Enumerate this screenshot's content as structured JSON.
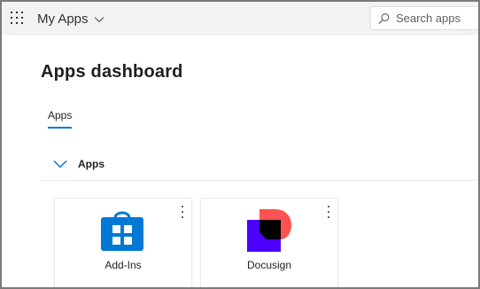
{
  "header": {
    "app_title": "My Apps",
    "search_placeholder": "Search apps"
  },
  "page": {
    "title": "Apps dashboard",
    "tabs": [
      {
        "label": "Apps",
        "selected": true
      }
    ]
  },
  "section": {
    "label": "Apps",
    "expanded": true
  },
  "apps": [
    {
      "name": "Add-Ins",
      "icon": "store-bag-icon"
    },
    {
      "name": "Docusign",
      "icon": "docusign-logo-icon"
    }
  ],
  "colors": {
    "accent": "#0078d4",
    "docusign_red": "#ff5252",
    "docusign_purple": "#4c00ff"
  }
}
